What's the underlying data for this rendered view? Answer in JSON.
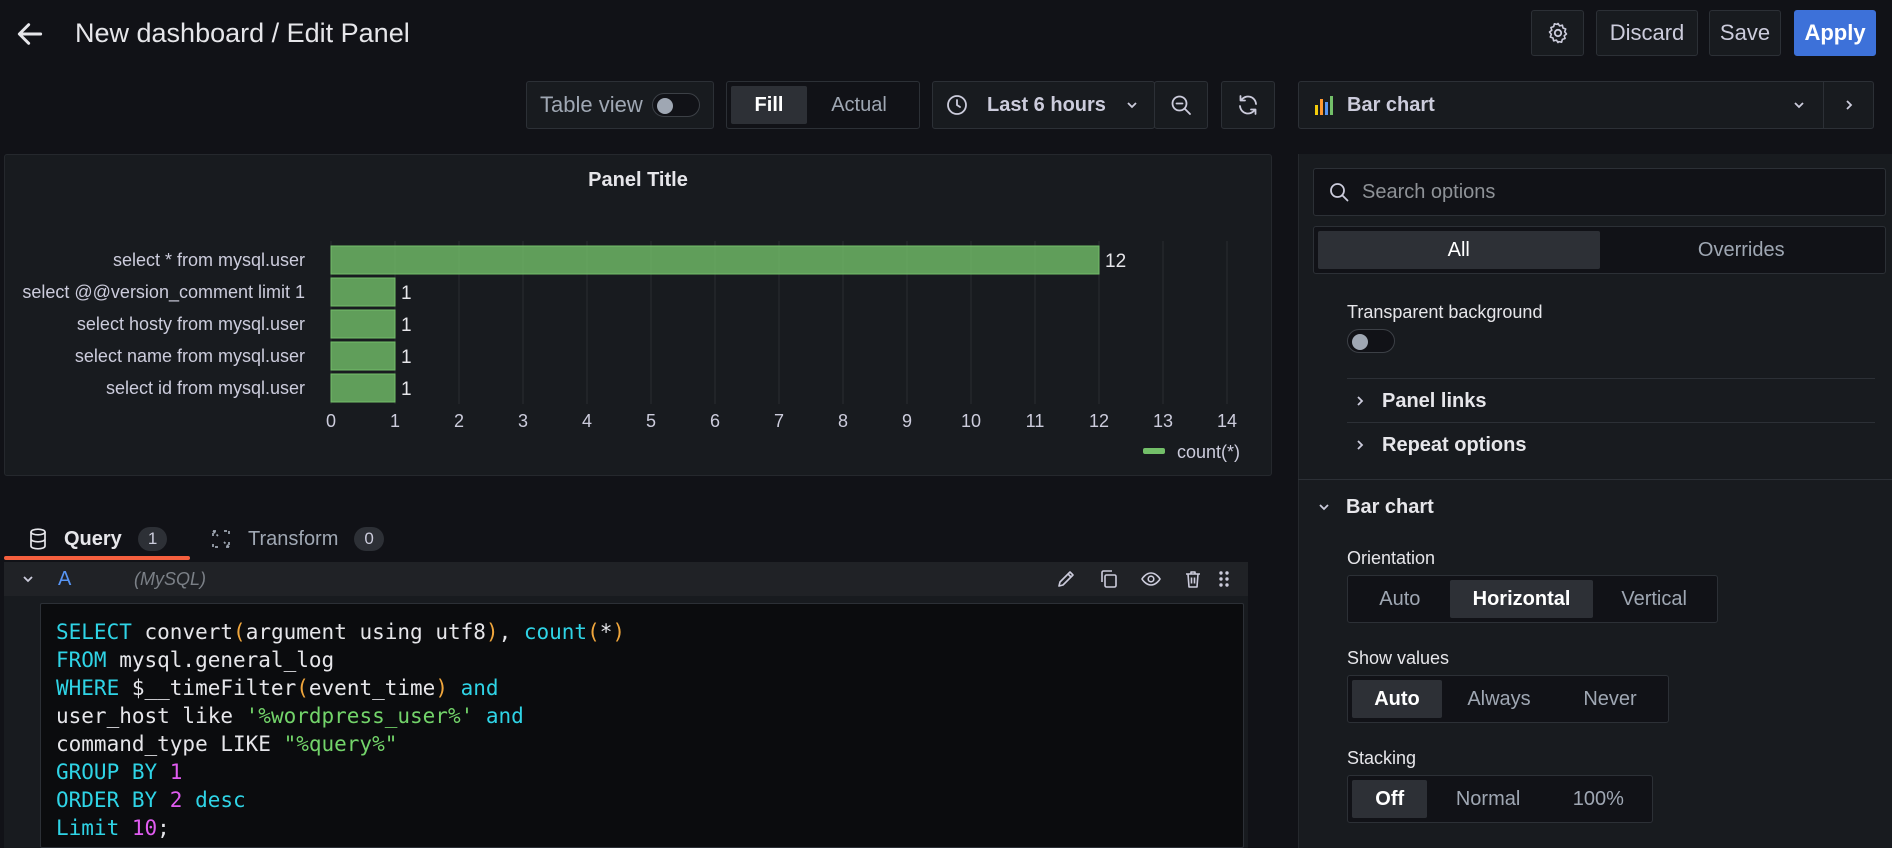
{
  "header": {
    "title": "New dashboard / Edit Panel",
    "discard_label": "Discard",
    "save_label": "Save",
    "apply_label": "Apply"
  },
  "toolbar": {
    "table_view_label": "Table view",
    "table_view_on": false,
    "fill_label": "Fill",
    "actual_label": "Actual",
    "time_range_label": "Last 6 hours",
    "visualization_label": "Bar chart"
  },
  "panel": {
    "title": "Panel Title"
  },
  "chart_data": {
    "type": "bar",
    "orientation": "horizontal",
    "title": "Panel Title",
    "categories": [
      "select * from mysql.user",
      "select @@version_comment limit 1",
      "select hosty from mysql.user",
      "select name from mysql.user",
      "select id from mysql.user"
    ],
    "series": [
      {
        "name": "count(*)",
        "values": [
          12,
          1,
          1,
          1,
          1
        ],
        "color": "#73bf69"
      }
    ],
    "xlim": [
      0,
      14
    ],
    "xticks": [
      0,
      1,
      2,
      3,
      4,
      5,
      6,
      7,
      8,
      9,
      10,
      11,
      12,
      13,
      14
    ],
    "grid": true,
    "legend": "bottom-right",
    "show_values": true
  },
  "query_tabs": {
    "query_label": "Query",
    "query_count": "1",
    "transform_label": "Transform",
    "transform_count": "0"
  },
  "query_row": {
    "ref_id": "A",
    "datasource": "(MySQL)"
  },
  "sql_lines": [
    [
      {
        "t": "SELECT ",
        "c": "kw"
      },
      {
        "t": "convert",
        "c": "txt"
      },
      {
        "t": "(",
        "c": "par"
      },
      {
        "t": "argument using utf8",
        "c": "txt"
      },
      {
        "t": ")",
        "c": "par"
      },
      {
        "t": ", ",
        "c": "txt"
      },
      {
        "t": "count",
        "c": "fn"
      },
      {
        "t": "(",
        "c": "par"
      },
      {
        "t": "*",
        "c": "txt"
      },
      {
        "t": ")",
        "c": "par"
      }
    ],
    [
      {
        "t": "FROM ",
        "c": "kw"
      },
      {
        "t": "mysql.general_log",
        "c": "txt"
      }
    ],
    [
      {
        "t": "WHERE ",
        "c": "kw"
      },
      {
        "t": "$__timeFilter",
        "c": "txt"
      },
      {
        "t": "(",
        "c": "par"
      },
      {
        "t": "event_time",
        "c": "txt"
      },
      {
        "t": ")",
        "c": "par"
      },
      {
        "t": " and",
        "c": "kw"
      }
    ],
    [
      {
        "t": "user_host like ",
        "c": "txt"
      },
      {
        "t": "'%wordpress_user%'",
        "c": "str"
      },
      {
        "t": " and",
        "c": "kw"
      }
    ],
    [
      {
        "t": "command_type LIKE ",
        "c": "txt"
      },
      {
        "t": "\"%query%\"",
        "c": "str"
      }
    ],
    [
      {
        "t": "GROUP BY ",
        "c": "kw"
      },
      {
        "t": "1",
        "c": "num"
      }
    ],
    [
      {
        "t": "ORDER BY ",
        "c": "kw"
      },
      {
        "t": "2",
        "c": "num"
      },
      {
        "t": " desc",
        "c": "kw"
      }
    ],
    [
      {
        "t": "Limit ",
        "c": "kw"
      },
      {
        "t": "10",
        "c": "num"
      },
      {
        "t": ";",
        "c": "txt"
      }
    ]
  ],
  "options": {
    "search_placeholder": "Search options",
    "tab_all": "All",
    "tab_overrides": "Overrides",
    "transparent_label": "Transparent background",
    "panel_links": "Panel links",
    "repeat_options": "Repeat options",
    "bar_chart_section": "Bar chart",
    "orientation_label": "Orientation",
    "orientation_opts": [
      "Auto",
      "Horizontal",
      "Vertical"
    ],
    "orientation_selected": "Horizontal",
    "show_values_label": "Show values",
    "show_values_opts": [
      "Auto",
      "Always",
      "Never"
    ],
    "show_values_selected": "Auto",
    "stacking_label": "Stacking",
    "stacking_opts": [
      "Off",
      "Normal",
      "100%"
    ],
    "stacking_selected": "Off"
  }
}
